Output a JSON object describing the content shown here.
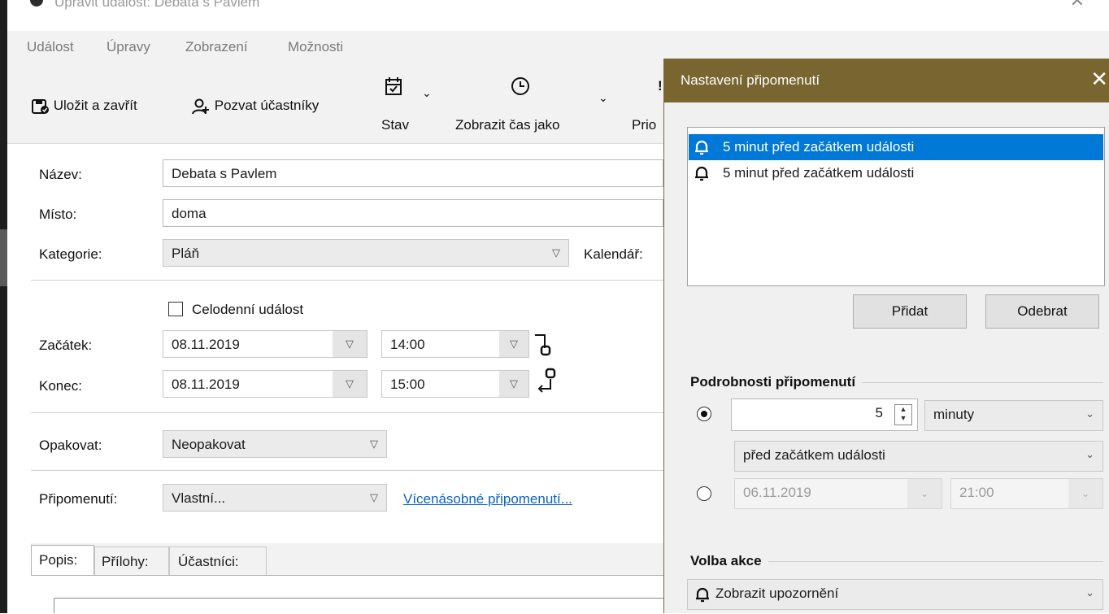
{
  "window": {
    "title": "Upravit událost: Debata s Pavlem"
  },
  "menu": [
    {
      "label": "Událost"
    },
    {
      "label": "Úpravy"
    },
    {
      "label": "Zobrazení"
    },
    {
      "label": "Možnosti"
    }
  ],
  "toolbar": {
    "save_close": "Uložit a zavřít",
    "invite": "Pozvat účastníky",
    "status": "Stav",
    "show_time_as": "Zobrazit čas jako",
    "priority": "Prio"
  },
  "form": {
    "name_label": "Název:",
    "name_value": "Debata s Pavlem",
    "location_label": "Místo:",
    "location_value": "doma",
    "category_label": "Kategorie:",
    "category_value": "Pláň",
    "calendar_label": "Kalendář:",
    "allday_label": "Celodenní událost",
    "start_label": "Začátek:",
    "start_date": "08.11.2019",
    "start_time": "14:00",
    "end_label": "Konec:",
    "end_date": "08.11.2019",
    "end_time": "15:00",
    "repeat_label": "Opakovat:",
    "repeat_value": "Neopakovat",
    "reminder_label": "Připomenutí:",
    "reminder_value": "Vlastní...",
    "multi_reminder_link": "Vícenásobné připomenutí..."
  },
  "tabs": [
    {
      "label": "Popis:"
    },
    {
      "label": "Přílohy:"
    },
    {
      "label": "Účastníci:"
    }
  ],
  "dialog": {
    "title": "Nastavení připomenutí",
    "reminders": [
      {
        "text": "5 minut před začátkem události",
        "selected": true
      },
      {
        "text": "5 minut před začátkem události",
        "selected": false
      }
    ],
    "add_button": "Přidat",
    "remove_button": "Odebrat",
    "details_title": "Podrobnosti připomenutí",
    "amount": "5",
    "unit": "minuty",
    "relation": "před začátkem události",
    "abs_date": "06.11.2019",
    "abs_time": "21:00",
    "action_title": "Volba akce",
    "action_value": "Zobrazit upozornění"
  },
  "colors": {
    "dialog_titlebar": "#786530",
    "selection": "#0078d7",
    "link": "#0b63c1"
  }
}
